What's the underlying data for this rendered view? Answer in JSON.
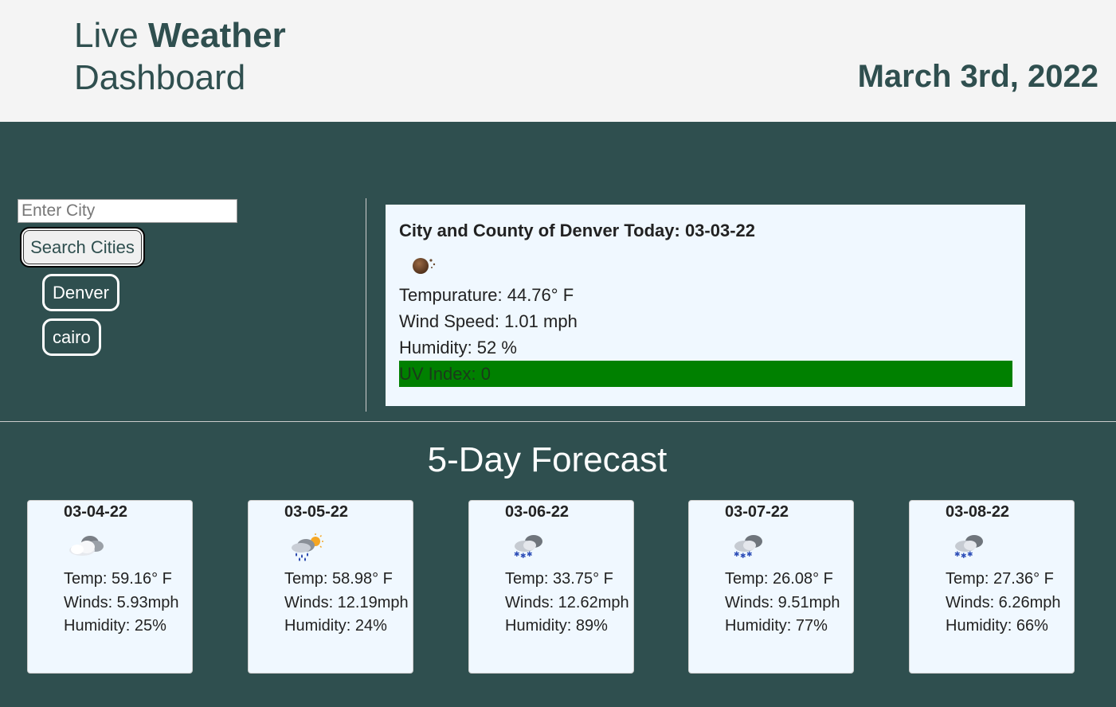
{
  "header": {
    "brand_light": "Live",
    "brand_bold": "Weather",
    "brand_line2": "Dashboard",
    "date": "March 3rd, 2022"
  },
  "search": {
    "placeholder": "Enter City",
    "button_label": "Search Cities",
    "history": [
      "Denver",
      "cairo"
    ]
  },
  "today": {
    "title": "City and County of Denver Today: 03-03-22",
    "icon": "clear-night-icon",
    "temperature": "Tempurature: 44.76° F",
    "wind": "Wind Speed: 1.01 mph",
    "humidity": "Humidity: 52 %",
    "uv": "UV Index: 0",
    "uv_color": "#008000"
  },
  "forecast": {
    "title": "5-Day Forecast",
    "days": [
      {
        "date": "03-04-22",
        "icon": "cloudy-icon",
        "temp": "Temp: 59.16° F",
        "wind": "Winds: 5.93mph",
        "humidity": "Humidity: 25%"
      },
      {
        "date": "03-05-22",
        "icon": "sun-rain-icon",
        "temp": "Temp: 58.98° F",
        "wind": "Winds: 12.19mph",
        "humidity": "Humidity: 24%"
      },
      {
        "date": "03-06-22",
        "icon": "snow-icon",
        "temp": "Temp: 33.75° F",
        "wind": "Winds: 12.62mph",
        "humidity": "Humidity: 89%"
      },
      {
        "date": "03-07-22",
        "icon": "snow-icon",
        "temp": "Temp: 26.08° F",
        "wind": "Winds: 9.51mph",
        "humidity": "Humidity: 77%"
      },
      {
        "date": "03-08-22",
        "icon": "snow-icon",
        "temp": "Temp: 27.36° F",
        "wind": "Winds: 6.26mph",
        "humidity": "Humidity: 66%"
      }
    ]
  },
  "colors": {
    "background": "#2f4f4f",
    "header_bg": "#f4f4f4",
    "card_bg": "#f0f8ff"
  }
}
